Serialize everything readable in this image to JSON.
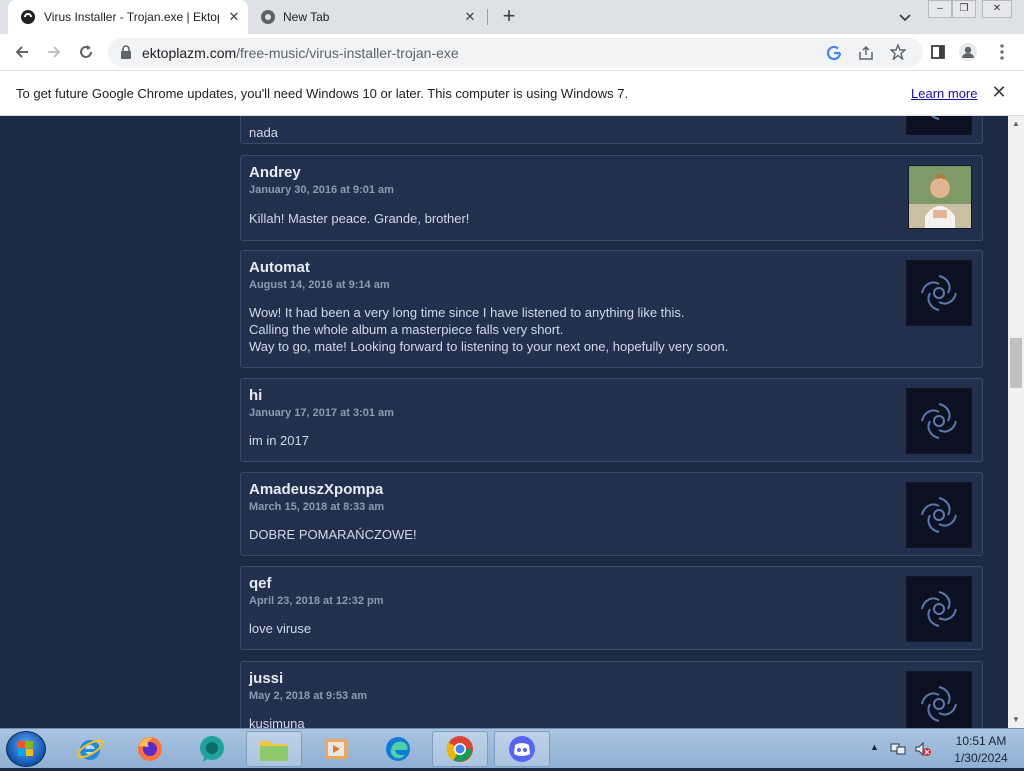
{
  "browser": {
    "tabs": [
      {
        "title": "Virus Installer - Trojan.exe | Ektop",
        "active": true
      },
      {
        "title": "New Tab",
        "active": false
      }
    ],
    "url_host": "ektoplazm.com",
    "url_path": "/free-music/virus-installer-trojan-exe"
  },
  "infobar": {
    "message": "To get future Google Chrome updates, you'll need Windows 10 or later. This computer is using Windows 7.",
    "link": "Learn more"
  },
  "comments": [
    {
      "author": "",
      "date": "",
      "body": [
        "nada"
      ],
      "avatar": "default-avatar"
    },
    {
      "author": "Andrey",
      "date": "January 30, 2016 at 9:01 am",
      "body": [
        "Killah! Master peace. Grande, brother!"
      ],
      "avatar": "photo-avatar"
    },
    {
      "author": "Automat",
      "date": "August 14, 2016 at 9:14 am",
      "body": [
        "Wow! It had been a very long time since I have listened to anything like this.",
        "Calling the whole album a masterpiece falls very short.",
        "Way to go, mate! Looking forward to listening to your next one, hopefully very soon."
      ],
      "avatar": "default-avatar"
    },
    {
      "author": "hi",
      "date": "January 17, 2017 at 3:01 am",
      "body": [
        "im in 2017"
      ],
      "avatar": "default-avatar"
    },
    {
      "author": "AmadeuszXpompa",
      "date": "March 15, 2018 at 8:33 am",
      "body": [
        "DOBRE POMARAŃCZOWE!"
      ],
      "avatar": "default-avatar"
    },
    {
      "author": "qef",
      "date": "April 23, 2018 at 12:32 pm",
      "body": [
        "love viruse"
      ],
      "avatar": "default-avatar"
    },
    {
      "author": "jussi",
      "date": "May 2, 2018 at 9:53 am",
      "body": [
        "kusimuna"
      ],
      "avatar": "default-avatar"
    }
  ],
  "taskbar": {
    "apps": [
      "internet-explorer",
      "firefox",
      "app-green",
      "file-explorer",
      "media-player",
      "edge",
      "chrome",
      "discord"
    ],
    "time": "10:51 AM",
    "date": "1/30/2024"
  }
}
